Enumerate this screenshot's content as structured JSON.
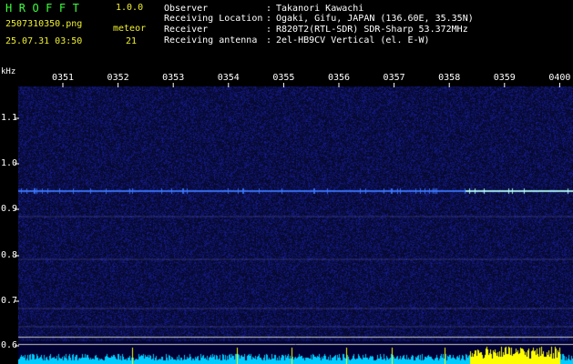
{
  "header": {
    "app_title": "HROFFT",
    "version": "1.0.0",
    "filename": "2507310350.png",
    "timestamp": "25.07.31 03:50",
    "meteor_label": "meteor",
    "meteor_count": "21"
  },
  "info": {
    "separator": ":",
    "rows": [
      {
        "key": "Observer",
        "value": "Takanori Kawachi"
      },
      {
        "key": "Receiving Location",
        "value": "Ogaki, Gifu, JAPAN (136.60E, 35.35N)"
      },
      {
        "key": "Receiver",
        "value": "R820T2(RTL-SDR) SDR-Sharp 53.372MHz"
      },
      {
        "key": "Receiving antenna",
        "value": "2el-HB9CV Vertical (el. E-W)"
      }
    ]
  },
  "axes": {
    "y_unit": "kHz",
    "time_labels": [
      "0351",
      "0352",
      "0353",
      "0354",
      "0355",
      "0356",
      "0357",
      "0358",
      "0359",
      "0400"
    ],
    "freq_labels": [
      "1.1",
      "1.0",
      "0.9",
      "0.8",
      "0.7",
      "0.6"
    ]
  },
  "colors": {
    "text_green": "#3cff3c",
    "text_yellow": "#f0f030",
    "background": "#000000",
    "waterfall_bg": "#000033",
    "signal_line": "#4080ff",
    "spectrum": "#00ccff",
    "spectrum_peak": "#ffff00"
  }
}
